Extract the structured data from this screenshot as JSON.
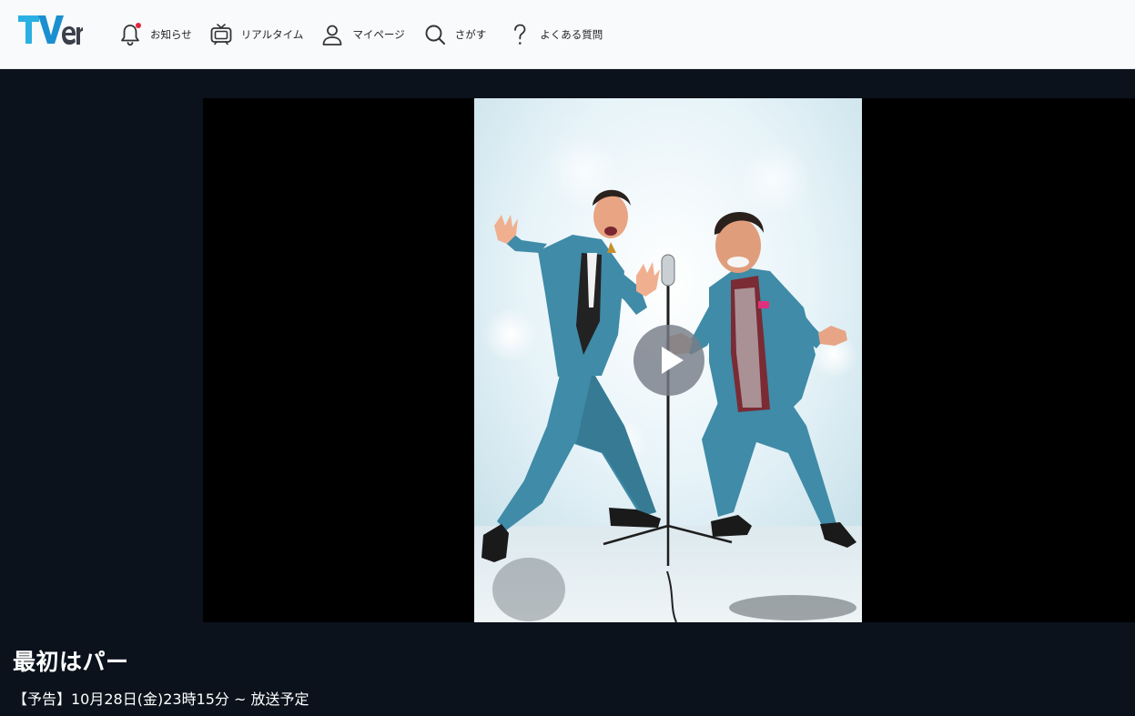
{
  "header": {
    "logo_text": "TVer",
    "nav": [
      {
        "label": "お知らせ",
        "icon": "bell-icon"
      },
      {
        "label": "リアルタイム",
        "icon": "tv-icon"
      },
      {
        "label": "マイページ",
        "icon": "user-icon"
      },
      {
        "label": "さがす",
        "icon": "search-icon"
      },
      {
        "label": "よくある質問",
        "icon": "question-icon"
      }
    ]
  },
  "player": {
    "poster_description_icon": "comedy-duo-poster",
    "play_icon": "play-icon"
  },
  "program": {
    "title": "最初はパー",
    "subtitle": "【予告】10月28日(金)23時15分 ~ 放送予定"
  },
  "colors": {
    "header_bg": "#f9fafc",
    "page_bg": "#0b121c",
    "logo_blue": "#1e9bd7",
    "notification_dot": "#e5223a"
  }
}
